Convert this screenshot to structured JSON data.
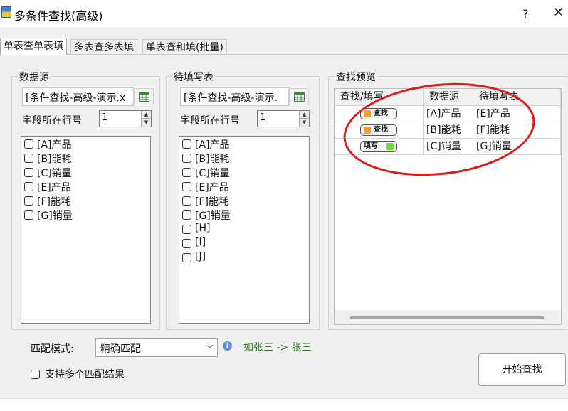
{
  "window": {
    "title": "多条件查找(高级)",
    "help": "?",
    "close": "✕"
  },
  "tabs": [
    {
      "label": "单表查单表填",
      "active": true
    },
    {
      "label": "多表查多表填",
      "active": false
    },
    {
      "label": "单表查和填(批量)",
      "active": false
    }
  ],
  "source": {
    "group_title": "数据源",
    "sheet": "[条件查找-高级-演示.x",
    "row_label": "字段所在行号",
    "row_value": "1",
    "fields": [
      {
        "label": "[A]产品",
        "checked": false
      },
      {
        "label": "[B]能耗",
        "checked": false
      },
      {
        "label": "[C]销量",
        "checked": false
      },
      {
        "label": "[E]产品",
        "checked": false
      },
      {
        "label": "[F]能耗",
        "checked": false
      },
      {
        "label": "[G]销量",
        "checked": false
      }
    ]
  },
  "target": {
    "group_title": "待填写表",
    "sheet": "[条件查找-高级-演示.",
    "row_label": "字段所在行号",
    "row_value": "1",
    "fields": [
      {
        "label": "[A]产品",
        "checked": false
      },
      {
        "label": "[B]能耗",
        "checked": false
      },
      {
        "label": "[C]销量",
        "checked": false
      },
      {
        "label": "[E]产品",
        "checked": false
      },
      {
        "label": "[F]能耗",
        "checked": false
      },
      {
        "label": "[G]销量",
        "checked": false
      },
      {
        "label": "[H]",
        "checked": false
      },
      {
        "label": "[I]",
        "checked": false
      },
      {
        "label": "[J]",
        "checked": false
      }
    ]
  },
  "preview": {
    "group_title": "查找预览",
    "columns": [
      "查找/填写",
      "数据源",
      "待填写表"
    ],
    "rows": [
      {
        "mode": "查找",
        "mode_color": "#f0a030",
        "source": "[A]产品",
        "target": "[E]产品"
      },
      {
        "mode": "查找",
        "mode_color": "#f0a030",
        "source": "[B]能耗",
        "target": "[F]能耗"
      },
      {
        "mode": "填写",
        "mode_color": "#77dd33",
        "source": "[C]销量",
        "target": "[G]销量"
      }
    ],
    "annotation_color": "#e01818"
  },
  "match": {
    "label": "匹配模式:",
    "value": "精确匹配",
    "example": "如张三 -> 张三",
    "example_color": "#2d7b1e"
  },
  "multi_result": {
    "label": "支持多个匹配结果",
    "checked": false
  },
  "start_button": {
    "label": "开始查找"
  }
}
